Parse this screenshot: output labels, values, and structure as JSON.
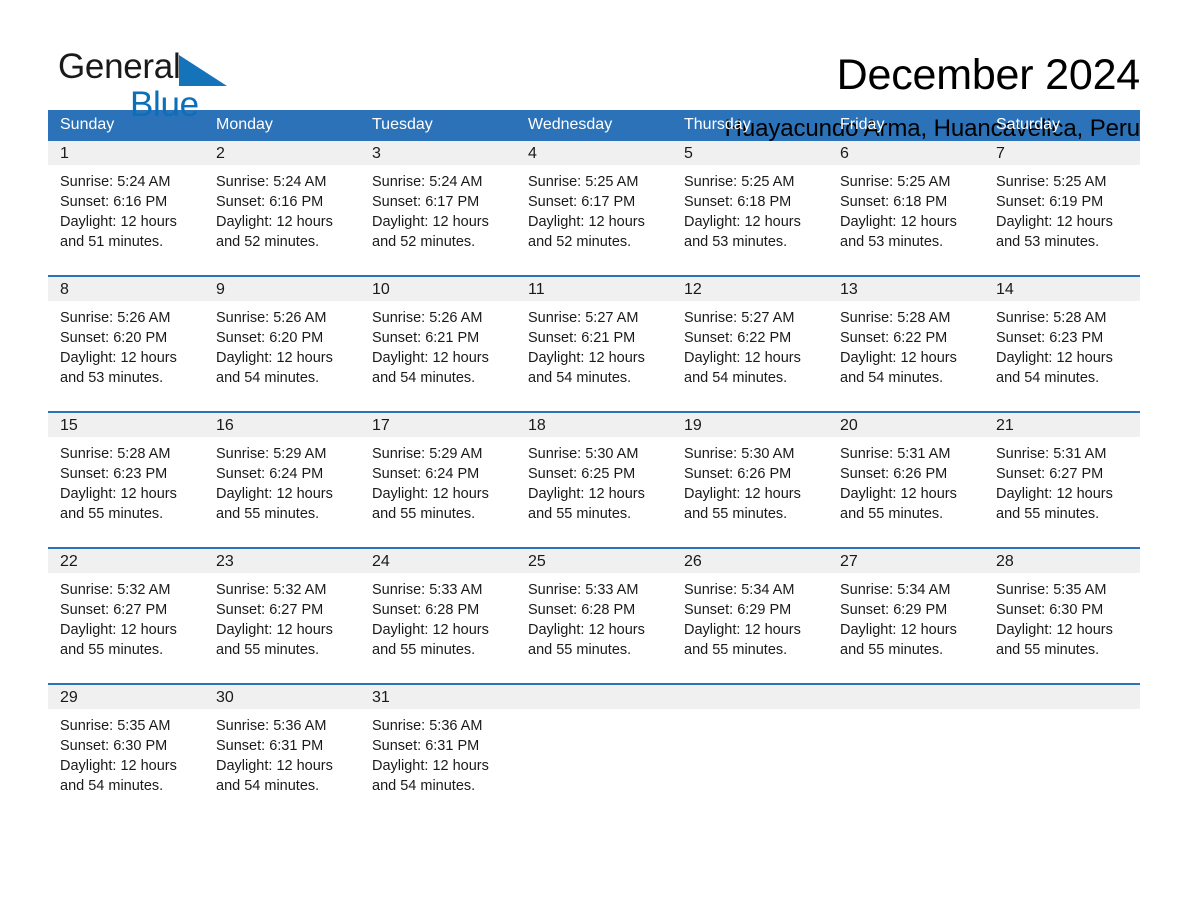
{
  "brand": {
    "name_part1": "General",
    "name_part2": "Blue",
    "triangle_color": "#1573b9",
    "text_color": "#1a1a1a",
    "blue_color": "#0b6fba"
  },
  "header": {
    "month_title": "December 2024",
    "location": "Huayacundo Arma, Huancavelica, Peru"
  },
  "theme": {
    "header_blue": "#2b72b8",
    "daynum_band": "#f0f0f0",
    "text": "#1a1a1a",
    "page_background": "#ffffff"
  },
  "weekdays": [
    "Sunday",
    "Monday",
    "Tuesday",
    "Wednesday",
    "Thursday",
    "Friday",
    "Saturday"
  ],
  "weeks": [
    [
      {
        "day": "1",
        "sunrise": "Sunrise: 5:24 AM",
        "sunset": "Sunset: 6:16 PM",
        "daylight_1": "Daylight: 12 hours",
        "daylight_2": "and 51 minutes."
      },
      {
        "day": "2",
        "sunrise": "Sunrise: 5:24 AM",
        "sunset": "Sunset: 6:16 PM",
        "daylight_1": "Daylight: 12 hours",
        "daylight_2": "and 52 minutes."
      },
      {
        "day": "3",
        "sunrise": "Sunrise: 5:24 AM",
        "sunset": "Sunset: 6:17 PM",
        "daylight_1": "Daylight: 12 hours",
        "daylight_2": "and 52 minutes."
      },
      {
        "day": "4",
        "sunrise": "Sunrise: 5:25 AM",
        "sunset": "Sunset: 6:17 PM",
        "daylight_1": "Daylight: 12 hours",
        "daylight_2": "and 52 minutes."
      },
      {
        "day": "5",
        "sunrise": "Sunrise: 5:25 AM",
        "sunset": "Sunset: 6:18 PM",
        "daylight_1": "Daylight: 12 hours",
        "daylight_2": "and 53 minutes."
      },
      {
        "day": "6",
        "sunrise": "Sunrise: 5:25 AM",
        "sunset": "Sunset: 6:18 PM",
        "daylight_1": "Daylight: 12 hours",
        "daylight_2": "and 53 minutes."
      },
      {
        "day": "7",
        "sunrise": "Sunrise: 5:25 AM",
        "sunset": "Sunset: 6:19 PM",
        "daylight_1": "Daylight: 12 hours",
        "daylight_2": "and 53 minutes."
      }
    ],
    [
      {
        "day": "8",
        "sunrise": "Sunrise: 5:26 AM",
        "sunset": "Sunset: 6:20 PM",
        "daylight_1": "Daylight: 12 hours",
        "daylight_2": "and 53 minutes."
      },
      {
        "day": "9",
        "sunrise": "Sunrise: 5:26 AM",
        "sunset": "Sunset: 6:20 PM",
        "daylight_1": "Daylight: 12 hours",
        "daylight_2": "and 54 minutes."
      },
      {
        "day": "10",
        "sunrise": "Sunrise: 5:26 AM",
        "sunset": "Sunset: 6:21 PM",
        "daylight_1": "Daylight: 12 hours",
        "daylight_2": "and 54 minutes."
      },
      {
        "day": "11",
        "sunrise": "Sunrise: 5:27 AM",
        "sunset": "Sunset: 6:21 PM",
        "daylight_1": "Daylight: 12 hours",
        "daylight_2": "and 54 minutes."
      },
      {
        "day": "12",
        "sunrise": "Sunrise: 5:27 AM",
        "sunset": "Sunset: 6:22 PM",
        "daylight_1": "Daylight: 12 hours",
        "daylight_2": "and 54 minutes."
      },
      {
        "day": "13",
        "sunrise": "Sunrise: 5:28 AM",
        "sunset": "Sunset: 6:22 PM",
        "daylight_1": "Daylight: 12 hours",
        "daylight_2": "and 54 minutes."
      },
      {
        "day": "14",
        "sunrise": "Sunrise: 5:28 AM",
        "sunset": "Sunset: 6:23 PM",
        "daylight_1": "Daylight: 12 hours",
        "daylight_2": "and 54 minutes."
      }
    ],
    [
      {
        "day": "15",
        "sunrise": "Sunrise: 5:28 AM",
        "sunset": "Sunset: 6:23 PM",
        "daylight_1": "Daylight: 12 hours",
        "daylight_2": "and 55 minutes."
      },
      {
        "day": "16",
        "sunrise": "Sunrise: 5:29 AM",
        "sunset": "Sunset: 6:24 PM",
        "daylight_1": "Daylight: 12 hours",
        "daylight_2": "and 55 minutes."
      },
      {
        "day": "17",
        "sunrise": "Sunrise: 5:29 AM",
        "sunset": "Sunset: 6:24 PM",
        "daylight_1": "Daylight: 12 hours",
        "daylight_2": "and 55 minutes."
      },
      {
        "day": "18",
        "sunrise": "Sunrise: 5:30 AM",
        "sunset": "Sunset: 6:25 PM",
        "daylight_1": "Daylight: 12 hours",
        "daylight_2": "and 55 minutes."
      },
      {
        "day": "19",
        "sunrise": "Sunrise: 5:30 AM",
        "sunset": "Sunset: 6:26 PM",
        "daylight_1": "Daylight: 12 hours",
        "daylight_2": "and 55 minutes."
      },
      {
        "day": "20",
        "sunrise": "Sunrise: 5:31 AM",
        "sunset": "Sunset: 6:26 PM",
        "daylight_1": "Daylight: 12 hours",
        "daylight_2": "and 55 minutes."
      },
      {
        "day": "21",
        "sunrise": "Sunrise: 5:31 AM",
        "sunset": "Sunset: 6:27 PM",
        "daylight_1": "Daylight: 12 hours",
        "daylight_2": "and 55 minutes."
      }
    ],
    [
      {
        "day": "22",
        "sunrise": "Sunrise: 5:32 AM",
        "sunset": "Sunset: 6:27 PM",
        "daylight_1": "Daylight: 12 hours",
        "daylight_2": "and 55 minutes."
      },
      {
        "day": "23",
        "sunrise": "Sunrise: 5:32 AM",
        "sunset": "Sunset: 6:27 PM",
        "daylight_1": "Daylight: 12 hours",
        "daylight_2": "and 55 minutes."
      },
      {
        "day": "24",
        "sunrise": "Sunrise: 5:33 AM",
        "sunset": "Sunset: 6:28 PM",
        "daylight_1": "Daylight: 12 hours",
        "daylight_2": "and 55 minutes."
      },
      {
        "day": "25",
        "sunrise": "Sunrise: 5:33 AM",
        "sunset": "Sunset: 6:28 PM",
        "daylight_1": "Daylight: 12 hours",
        "daylight_2": "and 55 minutes."
      },
      {
        "day": "26",
        "sunrise": "Sunrise: 5:34 AM",
        "sunset": "Sunset: 6:29 PM",
        "daylight_1": "Daylight: 12 hours",
        "daylight_2": "and 55 minutes."
      },
      {
        "day": "27",
        "sunrise": "Sunrise: 5:34 AM",
        "sunset": "Sunset: 6:29 PM",
        "daylight_1": "Daylight: 12 hours",
        "daylight_2": "and 55 minutes."
      },
      {
        "day": "28",
        "sunrise": "Sunrise: 5:35 AM",
        "sunset": "Sunset: 6:30 PM",
        "daylight_1": "Daylight: 12 hours",
        "daylight_2": "and 55 minutes."
      }
    ],
    [
      {
        "day": "29",
        "sunrise": "Sunrise: 5:35 AM",
        "sunset": "Sunset: 6:30 PM",
        "daylight_1": "Daylight: 12 hours",
        "daylight_2": "and 54 minutes."
      },
      {
        "day": "30",
        "sunrise": "Sunrise: 5:36 AM",
        "sunset": "Sunset: 6:31 PM",
        "daylight_1": "Daylight: 12 hours",
        "daylight_2": "and 54 minutes."
      },
      {
        "day": "31",
        "sunrise": "Sunrise: 5:36 AM",
        "sunset": "Sunset: 6:31 PM",
        "daylight_1": "Daylight: 12 hours",
        "daylight_2": "and 54 minutes."
      },
      {
        "day": "",
        "sunrise": "",
        "sunset": "",
        "daylight_1": "",
        "daylight_2": "",
        "empty": true
      },
      {
        "day": "",
        "sunrise": "",
        "sunset": "",
        "daylight_1": "",
        "daylight_2": "",
        "empty": true
      },
      {
        "day": "",
        "sunrise": "",
        "sunset": "",
        "daylight_1": "",
        "daylight_2": "",
        "empty": true
      },
      {
        "day": "",
        "sunrise": "",
        "sunset": "",
        "daylight_1": "",
        "daylight_2": "",
        "empty": true
      }
    ]
  ]
}
